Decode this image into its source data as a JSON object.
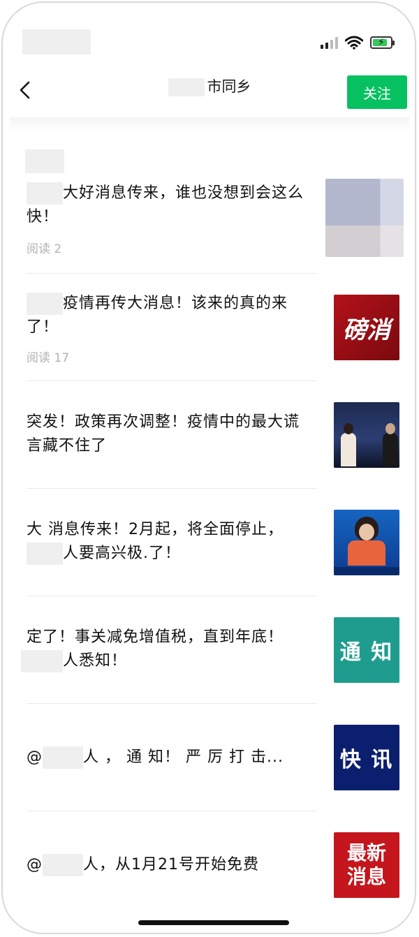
{
  "status_bar": {
    "signal_icon": "signal-icon",
    "wifi_icon": "wifi-icon",
    "battery_icon": "battery-charging-icon"
  },
  "header": {
    "back_icon": "chevron-left-icon",
    "title": "市同乡",
    "follow_label": "关注",
    "accent": "#07c160"
  },
  "articles": [
    {
      "title_rest": "大好消息传来，谁也没想到会这么快！",
      "reads": "阅读 2"
    },
    {
      "title_rest": "疫情再传大消息！该来的真的来了！",
      "reads": "阅读 17",
      "thumb_text": "磅消"
    },
    {
      "title": "突发！政策再次调整！疫情中的最大谎言藏不住了"
    },
    {
      "title_line1": "大 消息传来！2月起，将全面停止，",
      "title_line2": "人要高兴极.了！"
    },
    {
      "title_line1": "定了！事关减免增值税，直到年底！",
      "title_line2": "人悉知！",
      "thumb_text": "通 知"
    },
    {
      "title_prefix": "@",
      "title_suffix": "人 ， 通 知！ 严 厉 打 击...",
      "thumb_text": "快 讯"
    },
    {
      "title_prefix": "@",
      "title_suffix": "人，从1月21号开始免费",
      "thumb_text": "最新消息"
    }
  ]
}
